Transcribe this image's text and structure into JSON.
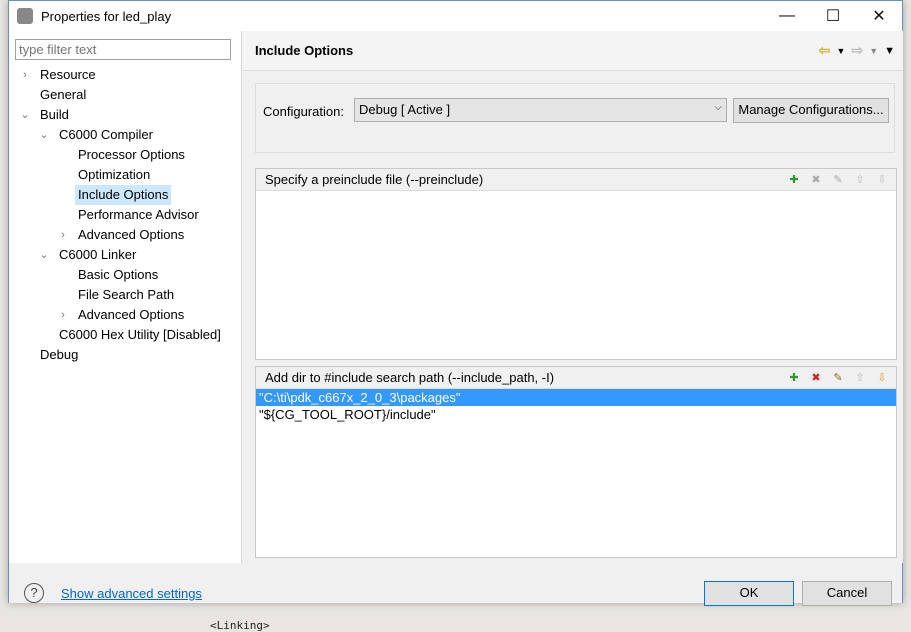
{
  "window": {
    "title": "Properties for led_play",
    "minimize": "—",
    "maximize": "☐",
    "close": "✕"
  },
  "background": {
    "text": "<Linking>"
  },
  "sidebar": {
    "filter_placeholder": "type filter text",
    "items": [
      {
        "label": "Resource",
        "level": 0,
        "twisty": "›"
      },
      {
        "label": "General",
        "level": 0,
        "twisty": ""
      },
      {
        "label": "Build",
        "level": 0,
        "twisty": "⌄"
      },
      {
        "label": "C6000 Compiler",
        "level": 1,
        "twisty": "⌄"
      },
      {
        "label": "Processor Options",
        "level": 2,
        "twisty": ""
      },
      {
        "label": "Optimization",
        "level": 2,
        "twisty": ""
      },
      {
        "label": "Include Options",
        "level": 2,
        "twisty": "",
        "selected": true
      },
      {
        "label": "Performance Advisor",
        "level": 2,
        "twisty": ""
      },
      {
        "label": "Advanced Options",
        "level": 2,
        "twisty": "›"
      },
      {
        "label": "C6000 Linker",
        "level": 1,
        "twisty": "⌄"
      },
      {
        "label": "Basic Options",
        "level": 2,
        "twisty": ""
      },
      {
        "label": "File Search Path",
        "level": 2,
        "twisty": ""
      },
      {
        "label": "Advanced Options",
        "level": 2,
        "twisty": "›"
      },
      {
        "label": "C6000 Hex Utility  [Disabled]",
        "level": 1,
        "twisty": ""
      },
      {
        "label": "Debug",
        "level": 0,
        "twisty": ""
      }
    ]
  },
  "main": {
    "title": "Include Options",
    "configuration_label": "Configuration:",
    "configuration_value": "Debug  [ Active ]",
    "manage_button": "Manage Configurations...",
    "preinclude": {
      "header": "Specify a preinclude file (--preinclude)",
      "rows": []
    },
    "include_path": {
      "header": "Add dir to #include search path (--include_path, -I)",
      "rows": [
        "\"C:\\ti\\pdk_c667x_2_0_3\\packages\"",
        "\"${CG_TOOL_ROOT}/include\""
      ]
    }
  },
  "footer": {
    "help": "?",
    "advanced_link": "Show advanced settings",
    "ok": "OK",
    "cancel": "Cancel"
  },
  "colors": {
    "selection": "#3399ff",
    "tree_selection": "#cce8ff",
    "link": "#0066cc"
  }
}
